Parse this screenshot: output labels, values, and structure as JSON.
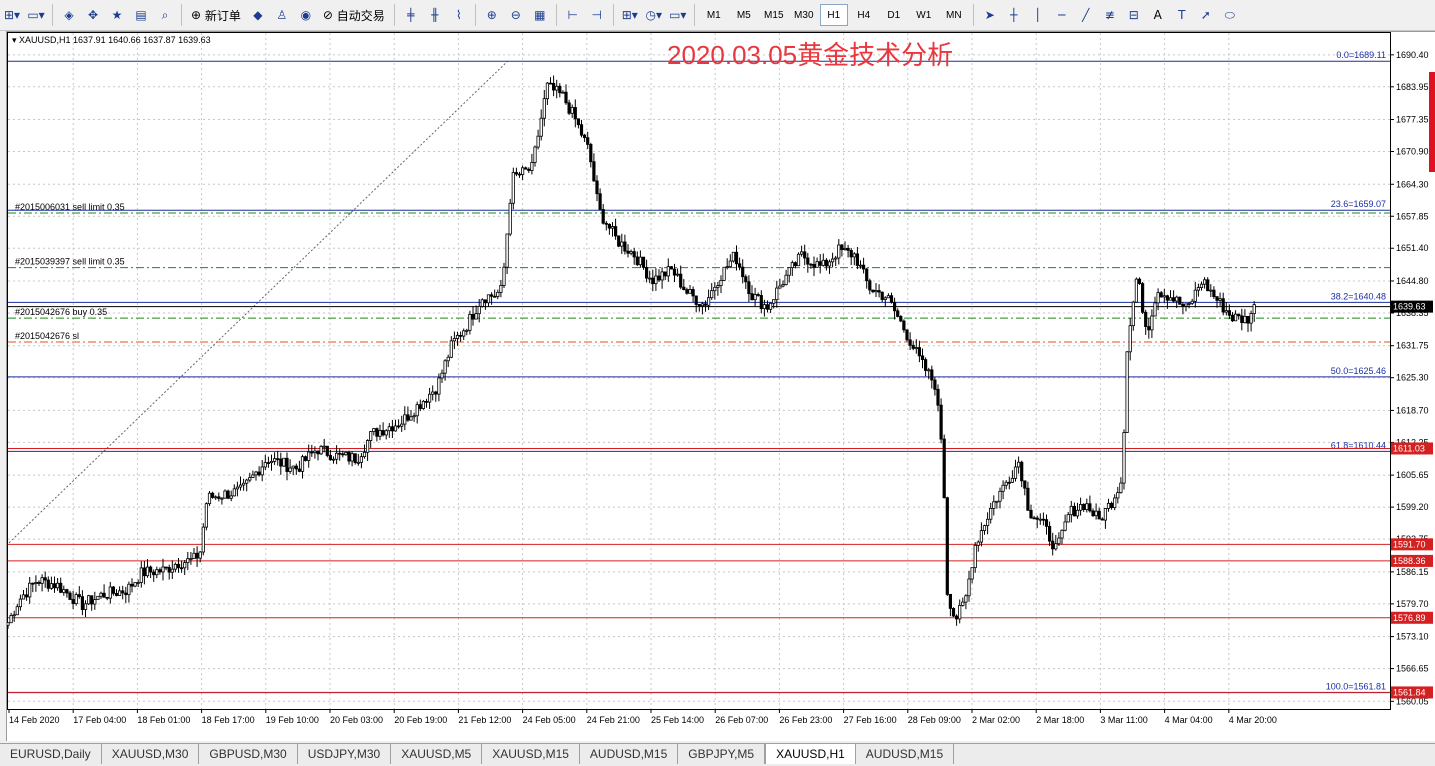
{
  "toolbar": {
    "new_order": "新订单",
    "auto_trading": "自动交易",
    "timeframes": [
      "M1",
      "M5",
      "M15",
      "M30",
      "H1",
      "H4",
      "D1",
      "W1",
      "MN"
    ],
    "selected_timeframe": "H1",
    "text_tool": "A"
  },
  "chart_info": {
    "symbol_line": "XAUUSD,H1  1637.91 1640.66 1637.87 1639.63",
    "title": "2020.03.05黄金技术分析"
  },
  "tabs": [
    "EURUSD,Daily",
    "XAUUSD,M30",
    "GBPUSD,M30",
    "USDJPY,M30",
    "XAUUSD,M5",
    "XAUUSD,M15",
    "AUDUSD,M15",
    "GBPJPY,M5",
    "XAUUSD,H1",
    "AUDUSD,M15"
  ],
  "active_tab": "XAUUSD,H1",
  "chart_data": {
    "type": "candlestick",
    "symbol": "XAUUSD",
    "timeframe": "H1",
    "ylim": [
      1558.5,
      1695.0
    ],
    "y_ticks": [
      "1690.40",
      "1683.95",
      "1677.35",
      "1670.90",
      "1664.30",
      "1657.85",
      "1651.40",
      "1644.80",
      "1638.35",
      "1631.75",
      "1625.30",
      "1618.70",
      "1612.25",
      "1605.65",
      "1599.20",
      "1592.75",
      "1586.15",
      "1579.70",
      "1573.10",
      "1566.65",
      "1560.05"
    ],
    "x_labels": [
      "14 Feb 2020",
      "17 Feb 04:00",
      "18 Feb 01:00",
      "18 Feb 17:00",
      "19 Feb 10:00",
      "20 Feb 03:00",
      "20 Feb 19:00",
      "21 Feb 12:00",
      "24 Feb 05:00",
      "24 Feb 21:00",
      "25 Feb 14:00",
      "26 Feb 07:00",
      "26 Feb 23:00",
      "27 Feb 16:00",
      "28 Feb 09:00",
      "2 Mar 02:00",
      "2 Mar 18:00",
      "3 Mar 11:00",
      "4 Mar 04:00",
      "4 Mar 20:00"
    ],
    "price_path": [
      [
        0,
        1575.5
      ],
      [
        12,
        1580.5
      ],
      [
        30,
        1584.5
      ],
      [
        50,
        1583.5
      ],
      [
        75,
        1579.5
      ],
      [
        95,
        1581.5
      ],
      [
        120,
        1582.5
      ],
      [
        135,
        1586.0
      ],
      [
        158,
        1586.5
      ],
      [
        170,
        1588.0
      ],
      [
        186,
        1588.5
      ],
      [
        193,
        1590.0
      ],
      [
        200,
        1601.0
      ],
      [
        210,
        1601.5
      ],
      [
        235,
        1602.5
      ],
      [
        260,
        1609.0
      ],
      [
        290,
        1607.0
      ],
      [
        310,
        1611.0
      ],
      [
        330,
        1609.5
      ],
      [
        350,
        1609.0
      ],
      [
        365,
        1614.0
      ],
      [
        395,
        1616.5
      ],
      [
        415,
        1620.5
      ],
      [
        430,
        1623.5
      ],
      [
        445,
        1632.0
      ],
      [
        460,
        1636.0
      ],
      [
        475,
        1641.5
      ],
      [
        488,
        1642.0
      ],
      [
        495,
        1643.0
      ],
      [
        505,
        1665.5
      ],
      [
        525,
        1667.5
      ],
      [
        540,
        1684.0
      ],
      [
        556,
        1682.0
      ],
      [
        568,
        1677.5
      ],
      [
        582,
        1671.0
      ],
      [
        592,
        1659.0
      ],
      [
        610,
        1653.0
      ],
      [
        628,
        1650.0
      ],
      [
        645,
        1645.0
      ],
      [
        665,
        1647.0
      ],
      [
        680,
        1642.5
      ],
      [
        697,
        1640.0
      ],
      [
        712,
        1645.5
      ],
      [
        728,
        1650.0
      ],
      [
        745,
        1642.0
      ],
      [
        760,
        1639.5
      ],
      [
        775,
        1644.5
      ],
      [
        795,
        1650.0
      ],
      [
        815,
        1647.5
      ],
      [
        832,
        1651.0
      ],
      [
        848,
        1650.0
      ],
      [
        862,
        1643.5
      ],
      [
        880,
        1641.5
      ],
      [
        895,
        1636.0
      ],
      [
        905,
        1632.0
      ],
      [
        915,
        1628.0
      ],
      [
        928,
        1624.0
      ],
      [
        936,
        1610.0
      ],
      [
        940,
        1582.5
      ],
      [
        948,
        1576.5
      ],
      [
        958,
        1580.0
      ],
      [
        968,
        1591.5
      ],
      [
        985,
        1599.5
      ],
      [
        1000,
        1604.5
      ],
      [
        1012,
        1608.5
      ],
      [
        1022,
        1598.5
      ],
      [
        1035,
        1596.0
      ],
      [
        1050,
        1590.5
      ],
      [
        1062,
        1598.0
      ],
      [
        1078,
        1600.0
      ],
      [
        1092,
        1596.5
      ],
      [
        1105,
        1600.5
      ],
      [
        1115,
        1605.0
      ],
      [
        1120,
        1631.0
      ],
      [
        1130,
        1646.0
      ],
      [
        1140,
        1634.5
      ],
      [
        1150,
        1643.0
      ],
      [
        1165,
        1641.5
      ],
      [
        1180,
        1639.0
      ],
      [
        1195,
        1645.0
      ],
      [
        1210,
        1641.0
      ],
      [
        1225,
        1637.5
      ],
      [
        1240,
        1637.0
      ],
      [
        1248,
        1639.63
      ]
    ],
    "fibonacci": [
      {
        "level": "0.0",
        "value": 1689.11,
        "label": "0.0=1689.11"
      },
      {
        "level": "23.6",
        "value": 1659.07,
        "label": "23.6=1659.07"
      },
      {
        "level": "38.2",
        "value": 1640.48,
        "label": "38.2=1640.48"
      },
      {
        "level": "50.0",
        "value": 1625.46,
        "label": "50.0=1625.46"
      },
      {
        "level": "61.8",
        "value": 1610.44,
        "label": "61.8=1610.44"
      },
      {
        "level": "100.0",
        "value": 1561.81,
        "label": "100.0=1561.81"
      }
    ],
    "orders": [
      {
        "label": "#2015006031 sell limit 0.35",
        "value": 1658.5,
        "color": "#1a8a1a"
      },
      {
        "label": "#2015039397 sell limit 0.35",
        "value": 1647.5,
        "color": "#1a8a1a"
      },
      {
        "label": "#2015042676 buy 0.35",
        "value": 1637.3,
        "color": "#1a8a1a"
      },
      {
        "label": "#2015042676 sl",
        "value": 1632.5,
        "color": "#e0541c"
      }
    ],
    "level_lines": [
      {
        "value": 1591.7,
        "label": "1591.70"
      },
      {
        "value": 1588.36,
        "label": "1588.36"
      },
      {
        "value": 1576.89,
        "label": "1576.89"
      },
      {
        "value": 1561.84,
        "label": "1561.84"
      },
      {
        "value": 1611.03,
        "label": "1611.03"
      }
    ],
    "current_price": {
      "value": 1639.63,
      "label": "1639.63"
    },
    "trend_line": {
      "from": {
        "x_label": "14 Feb 2020",
        "value": 1592.0
      },
      "to": {
        "x_label": "24 Feb 05:00",
        "value": 1689.11
      }
    }
  },
  "colors": {
    "up": "#000000",
    "down": "#000000",
    "fib": "#1c2fa0",
    "level": "#d42020",
    "order": "#1a8a1a",
    "sl": "#e0541c",
    "title": "#e8373e"
  }
}
